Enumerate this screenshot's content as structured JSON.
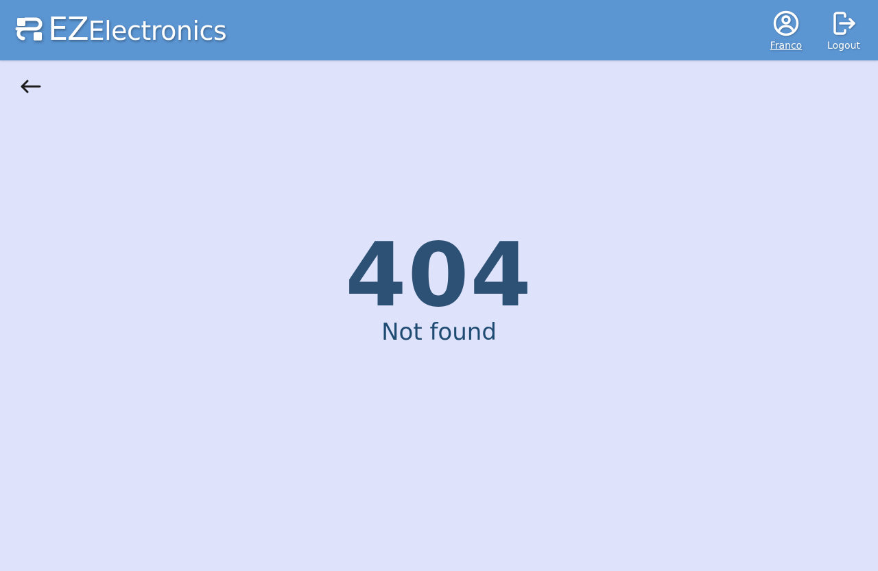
{
  "header": {
    "brand_short": "EZ",
    "brand_name": "Electronics",
    "brand_icon": "cable-connector-icon",
    "profile": {
      "label": "Franco",
      "icon": "account-circle-icon"
    },
    "logout": {
      "label": "Logout",
      "icon": "logout-icon"
    }
  },
  "main": {
    "back_icon": "arrow-left-icon",
    "error_code": "404",
    "error_message": "Not found"
  },
  "colors": {
    "header_bg": "#5b95d2",
    "page_bg": "#dee3fb",
    "error_code": "#2c5175",
    "error_message": "#1f4b72"
  }
}
